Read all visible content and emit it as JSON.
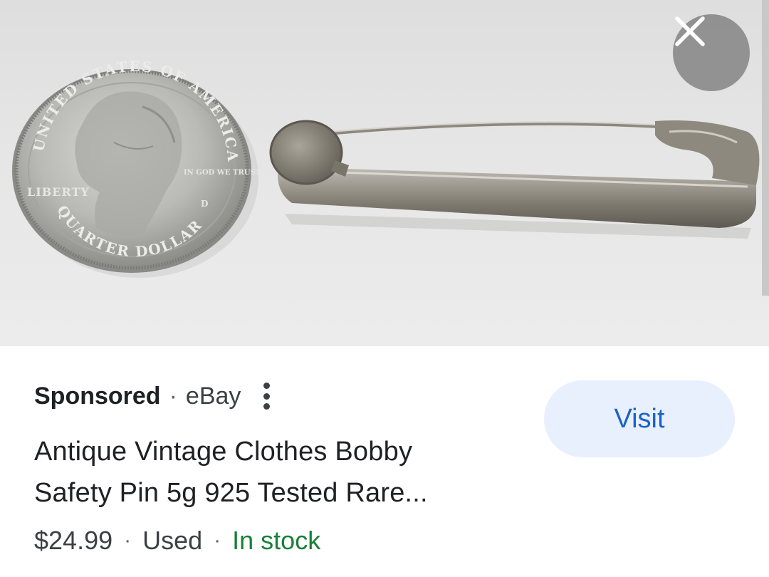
{
  "image": {
    "subject": "coin-and-safety-pin-photo",
    "coin_text": {
      "top_arc": "UNITED STATES OF AMERICA",
      "left": "LIBERTY",
      "motto": "IN GOD WE TRUST",
      "bottom_arc": "QUARTER DOLLAR",
      "mint_mark": "D"
    }
  },
  "close_button": {
    "icon": "close-icon"
  },
  "ad": {
    "sponsored_label": "Sponsored",
    "separator": "·",
    "source": "eBay",
    "more_icon": "more-vert-icon",
    "title_line1": "Antique Vintage Clothes Bobby",
    "title_line2": "Safety Pin 5g 925 Tested Rare...",
    "price": "$24.99",
    "condition": "Used",
    "availability": "In stock",
    "visit_label": "Visit"
  },
  "colors": {
    "accent_button_bg": "#e8f0fe",
    "accent_button_text": "#1a62c7",
    "stock_green": "#188038",
    "text_primary": "#202124"
  }
}
